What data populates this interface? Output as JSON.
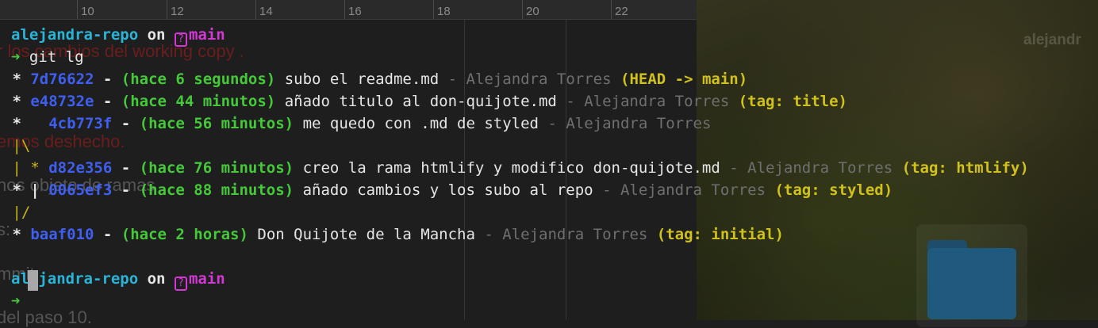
{
  "background_doc": {
    "ruler_ticks": [
      "10",
      "12",
      "14",
      "16",
      "18",
      "20",
      "22"
    ],
    "fragments": [
      "r los cambios del working copy .",
      "emos deshecho.",
      "nos objeto de ramas",
      "s:",
      "mmit",
      "del paso 10."
    ]
  },
  "desktop": {
    "wallpaper_label": "alejandr"
  },
  "terminal": {
    "prompt1": {
      "repo": "alejandra-repo",
      "on": "on",
      "branch_icon": "?",
      "branch": "main"
    },
    "command": {
      "arrow": "➜",
      "text": "git lg"
    },
    "log": [
      {
        "graph": " *",
        "hash": "7d76622",
        "dash": "-",
        "time": "(hace 6 segundos)",
        "msg": "subo el readme.md",
        "sep": "-",
        "author": "Alejandra Torres",
        "ref": "(HEAD -> main)"
      },
      {
        "graph": " *",
        "hash": "e48732e",
        "dash": "-",
        "time": "(hace 44 minutos)",
        "msg": "añado titulo al don-quijote.md",
        "sep": "-",
        "author": "Alejandra Torres",
        "ref": "(tag: title)"
      },
      {
        "graph": " *  ",
        "hash": "4cb773f",
        "dash": "-",
        "time": "(hace 56 minutos)",
        "msg": "me quedo con .md de styled",
        "sep": "-",
        "author": "Alejandra Torres",
        "ref": ""
      },
      {
        "graph": " |\\",
        "hash": "",
        "dash": "",
        "time": "",
        "msg": "",
        "sep": "",
        "author": "",
        "ref": ""
      },
      {
        "graph": " | *",
        "hash": "d82e356",
        "dash": "-",
        "time": "(hace 76 minutos)",
        "msg": "creo la rama htmlify y modifico don-quijote.md",
        "sep": "-",
        "author": "Alejandra Torres",
        "ref": "(tag: htmlify)"
      },
      {
        "graph": " * |",
        "hash": "0065ef3",
        "dash": "-",
        "time": "(hace 88 minutos)",
        "msg": "añado cambios y los subo al repo",
        "sep": "-",
        "author": "Alejandra Torres",
        "ref": "(tag: styled)"
      },
      {
        "graph": " |/",
        "hash": "",
        "dash": "",
        "time": "",
        "msg": "",
        "sep": "",
        "author": "",
        "ref": ""
      },
      {
        "graph": " *",
        "hash": "baaf010",
        "dash": "-",
        "time": "(hace 2 horas)",
        "msg": "Don Quijote de la Mancha",
        "sep": "-",
        "author": "Alejandra Torres",
        "ref": "(tag: initial)"
      }
    ],
    "prompt2": {
      "repo": "alejandra-repo",
      "on": "on",
      "branch_icon": "?",
      "branch": "main"
    },
    "prompt3": {
      "arrow": "➜"
    }
  }
}
